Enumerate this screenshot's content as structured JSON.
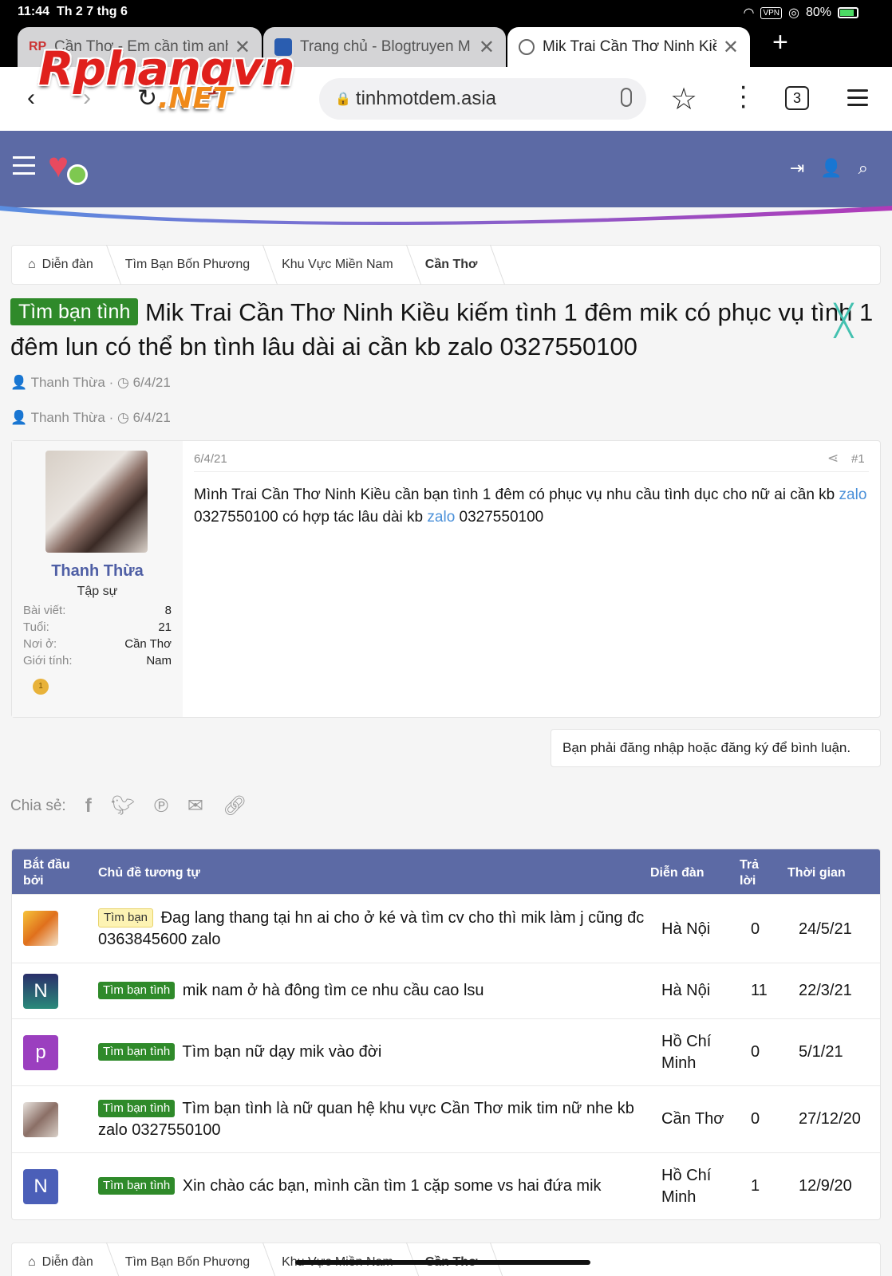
{
  "status": {
    "time": "11:44",
    "date": "Th 2 7 thg 6",
    "battery": "80%",
    "vpn": "VPN"
  },
  "tabs": [
    {
      "title": "Cần Thơ - Em cần tìm anh",
      "fav_text": "RP"
    },
    {
      "title": "Trang chủ - Blogtruyen M",
      "fav_text": ""
    },
    {
      "title": "Mik Trai Cần Thơ Ninh Kiều",
      "fav_text": ""
    }
  ],
  "browser": {
    "url": "tinhmotdem.asia",
    "tab_count": "3"
  },
  "watermark": {
    "line1": "Rphangvn",
    "line2": ".NET"
  },
  "breadcrumb": [
    "Diễn đàn",
    "Tìm Bạn Bốn Phương",
    "Khu Vực Miền Nam",
    "Cần Thơ"
  ],
  "thread": {
    "prefix": "Tìm bạn tình",
    "title": " Mik Trai Cần Thơ Ninh Kiều kiếm tình 1 đêm mik có phục vụ tình 1 đêm lun có thể bn tình lâu dài ai cần kb zalo 0327550100",
    "author": "Thanh Thừa",
    "date": "6/4/21"
  },
  "post": {
    "date": "6/4/21",
    "number": "#1",
    "body_part1": "Mình Trai Cần Thơ Ninh Kiều cần bạn tình 1 đêm có phục vụ nhu cầu tình dục cho nữ ai cần kb ",
    "link1": "zalo",
    "body_part2": " 0327550100 có hợp tác lâu dài kb ",
    "link2": "zalo",
    "body_part3": " 0327550100",
    "user": {
      "name": "Thanh Thừa",
      "rank": "Tập sự",
      "stats": [
        {
          "label": "Bài viết:",
          "value": "8"
        },
        {
          "label": "Tuổi:",
          "value": "21"
        },
        {
          "label": "Nơi ở:",
          "value": "Cần Thơ"
        },
        {
          "label": "Giới tính:",
          "value": "Nam"
        }
      ],
      "trophy": "1"
    }
  },
  "login_note": "Bạn phải đăng nhập hoặc đăng ký để bình luận.",
  "share": {
    "label": "Chia sẻ:"
  },
  "similar": {
    "headers": {
      "starter": "Bắt đầu bởi",
      "topic": "Chủ đề tương tự",
      "forum": "Diễn đàn",
      "replies": "Trả lời",
      "time": "Thời gian"
    },
    "rows": [
      {
        "avatar_text": "",
        "prefix": "Tìm bạn",
        "title": " Đag lang thang tại hn ai cho ở ké và tìm cv cho thì mik làm j cũng đc 0363845600 zalo",
        "forum": "Hà Nội",
        "replies": "0",
        "date": "24/5/21"
      },
      {
        "avatar_text": "N",
        "prefix": "Tìm bạn tình",
        "title": " mik nam ở hà đông tìm ce nhu cầu cao lsu",
        "forum": "Hà Nội",
        "replies": "11",
        "date": "22/3/21"
      },
      {
        "avatar_text": "p",
        "prefix": "Tìm bạn tình",
        "title": " Tìm bạn nữ dạy mik vào đời",
        "forum": "Hồ Chí Minh",
        "replies": "0",
        "date": "5/1/21"
      },
      {
        "avatar_text": "",
        "prefix": "Tìm bạn tình",
        "title": " Tìm bạn tình là nữ quan hệ khu vực Cần Thơ mik tim nữ nhe kb zalo 0327550100",
        "forum": "Cần Thơ",
        "replies": "0",
        "date": "27/12/20"
      },
      {
        "avatar_text": "N",
        "prefix": "Tìm bạn tình",
        "title": " Xin chào các bạn, mình cần tìm 1 cặp some vs hai đứa mik",
        "forum": "Hồ Chí Minh",
        "replies": "1",
        "date": "12/9/20"
      }
    ]
  },
  "colors": {
    "header": "#5c6aa5",
    "prefix_green": "#2f8a2a",
    "link": "#4a90d9"
  }
}
